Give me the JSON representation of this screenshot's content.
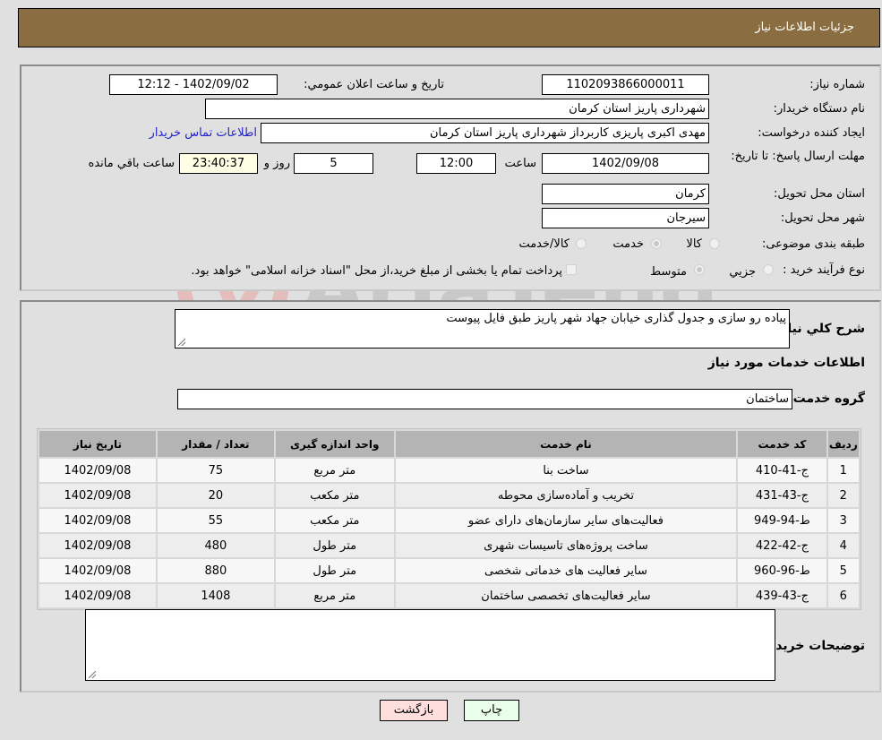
{
  "header": {
    "title": "جزئیات اطلاعات نیاز"
  },
  "form": {
    "need_number": {
      "label": "شماره نیاز:",
      "value": "1102093866000011"
    },
    "announce_datetime": {
      "label": "تاریخ و ساعت اعلان عمومي:",
      "value": "1402/09/02 - 12:12"
    },
    "buyer_org": {
      "label": "نام دستگاه خریدار:",
      "value": "شهرداری پاریز استان کرمان"
    },
    "requester": {
      "label": "ایجاد کننده درخواست:",
      "value": "مهدی اکبری پاریزی کاربرداز شهرداری پاریز استان کرمان"
    },
    "buyer_contact_link": "اطلاعات تماس خریدار",
    "deadline": {
      "label": "مهلت ارسال پاسخ: تا تاریخ:",
      "date": "1402/09/08",
      "time_label": "ساعت",
      "time": "12:00",
      "days": "5",
      "days_label": "روز و",
      "remaining": "23:40:37",
      "remaining_label": "ساعت باقي مانده"
    },
    "delivery_province": {
      "label": "استان محل تحویل:",
      "value": "کرمان"
    },
    "delivery_city": {
      "label": "شهر محل تحویل:",
      "value": "سیرجان"
    },
    "category": {
      "label": "طبقه بندی موضوعی:",
      "options": [
        "کالا",
        "خدمت",
        "کالا/خدمت"
      ],
      "selected": "خدمت"
    },
    "purchase_type": {
      "label": "نوع فرآیند خرید :",
      "options": [
        "جزيي",
        "متوسط"
      ],
      "selected": "متوسط",
      "treasury_note": "پرداخت تمام یا بخشی از مبلغ خرید،از محل \"اسناد خزانه اسلامی\" خواهد بود."
    }
  },
  "details": {
    "description_label": "شرح کلي نیاز:",
    "description_value": "پیاده رو سازی و جدول گذاری خیابان جهاد شهر پاریز طبق فایل پیوست",
    "services_title": "اطلاعات خدمات مورد نیاز",
    "service_group_label": "گروه خدمت:",
    "service_group_value": "ساختمان",
    "table": {
      "headers": [
        "ردیف",
        "کد خدمت",
        "نام خدمت",
        "واحد اندازه گیری",
        "تعداد / مقدار",
        "تاریخ نیاز"
      ],
      "rows": [
        [
          "1",
          "ج-41-410",
          "ساخت بنا",
          "متر مربع",
          "75",
          "1402/09/08"
        ],
        [
          "2",
          "ج-43-431",
          "تخریب و آماده‌سازی محوطه",
          "متر مکعب",
          "20",
          "1402/09/08"
        ],
        [
          "3",
          "ط-94-949",
          "فعالیت‌های سایر سازمان‌های دارای عضو",
          "متر مکعب",
          "55",
          "1402/09/08"
        ],
        [
          "4",
          "ج-42-422",
          "ساخت پروژه‌های تاسیسات شهری",
          "متر طول",
          "480",
          "1402/09/08"
        ],
        [
          "5",
          "ط-96-960",
          "سایر فعالیت های خدماتی شخصی",
          "متر طول",
          "880",
          "1402/09/08"
        ],
        [
          "6",
          "ج-43-439",
          "سایر فعالیت‌های تخصصی ساختمان",
          "متر مربع",
          "1408",
          "1402/09/08"
        ]
      ]
    },
    "buyer_notes_label": "توضیحات خریدار:",
    "buyer_notes_value": ""
  },
  "buttons": {
    "print": "چاپ",
    "back": "بازگشت"
  },
  "colors": {
    "header_bg": "#8b6d42",
    "print_bg": "#eaffea",
    "back_bg": "#ffdede",
    "link": "#2222cc"
  },
  "watermark": "AriaTender.neT"
}
